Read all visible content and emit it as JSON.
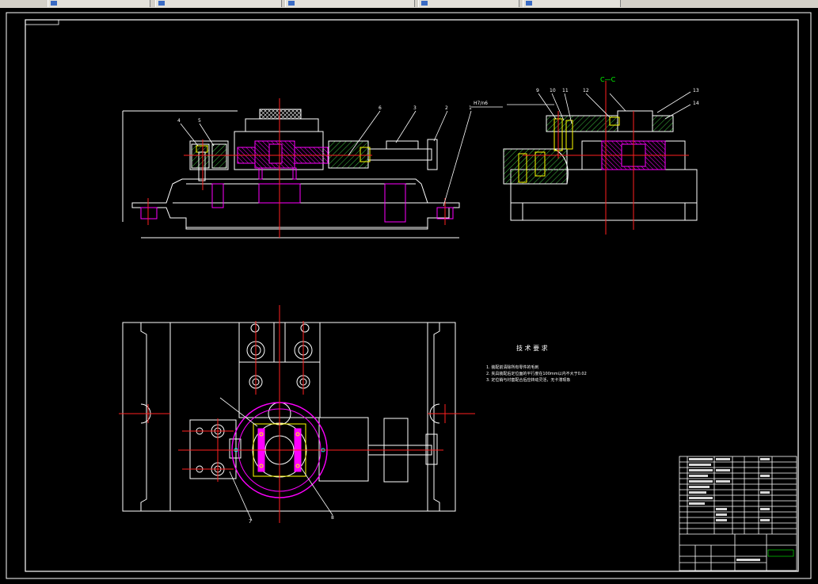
{
  "taskbar": {
    "tabs": [
      {
        "label": "",
        "icon": "window-icon"
      },
      {
        "label": "",
        "icon": "window-icon"
      },
      {
        "label": "",
        "icon": "window-icon"
      },
      {
        "label": "",
        "icon": "window-icon"
      },
      {
        "label": "",
        "icon": "window-icon"
      }
    ]
  },
  "drawing": {
    "section_label": "C—C",
    "tech_req_title": "技 术 要 求",
    "tech_req_items": [
      "1. 装配前清除所有零件的毛刺",
      "2. 夹具装配后定位面的平行度在100mm以内不大于0.02",
      "3. 定位销与衬套配合后应转动灵活，无卡滞现象"
    ],
    "tech_req_tag": "",
    "fit_note": "H7/n6",
    "top_balloons": [
      "9",
      "10",
      "11",
      "12",
      "13",
      "14"
    ],
    "left_balloons": [
      "4",
      "5",
      "6",
      "3",
      "2",
      "1"
    ],
    "plan_balloons": [
      "7",
      "8"
    ],
    "title_text": "",
    "colors": {
      "outline": "#ffffff",
      "center": "#ff2020",
      "magenta": "#ff00ff",
      "hatch": "#40c040",
      "yellow": "#ffff00",
      "cyan": "#00ffff",
      "green_text": "#00ff00"
    }
  }
}
